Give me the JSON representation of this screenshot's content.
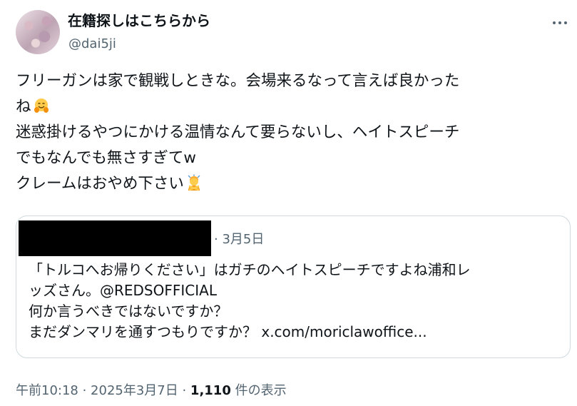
{
  "author": {
    "display_name": "在籍探しはこちらから",
    "handle": "@dai5ji"
  },
  "tweet": {
    "line1": "フリーガンは家で観戦しときな。会場来るなって言えば良かった",
    "line2": "ね",
    "line3": "迷惑掛けるやつにかける温情なんて要らないし、ヘイトスピーチ",
    "line4": "でもなんでも無さすぎてw",
    "line5": "クレームはおやめ下さい",
    "emoji_1": "hugging-face-emoji",
    "emoji_2": "person-gesturing-no-emoji"
  },
  "quote": {
    "date": "· 3月5日",
    "line1": "「トルコへお帰りください」はガチのヘイトスピーチですよね浦和レ",
    "line2": "ッズさん。@REDSOFFICIAL",
    "line3": "何か言うべきではないですか？",
    "line4": "まだダンマリを通すつもりですか？ x.com/moriclawoffice..."
  },
  "meta": {
    "time": "午前10:18 · 2025年3月7日 · ",
    "views_count": "1,110",
    "views_label": " 件の表示"
  },
  "colors": {
    "text": "#0f1419",
    "muted": "#536471",
    "border": "#cfd9de"
  }
}
